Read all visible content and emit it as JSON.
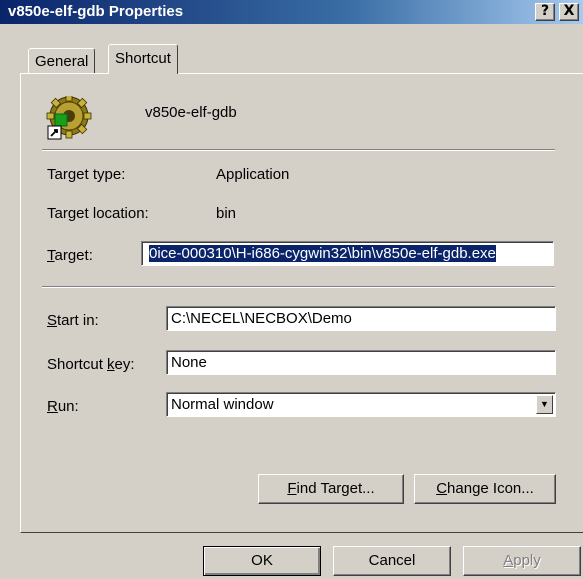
{
  "window": {
    "title": "v850e-elf-gdb  Properties",
    "help_glyph": "?",
    "close_glyph": "X"
  },
  "tabs": [
    {
      "label": "General",
      "active": false
    },
    {
      "label": "Shortcut",
      "active": true
    }
  ],
  "shortcut": {
    "icon": "gear-shortcut-icon",
    "name": "v850e-elf-gdb",
    "target_type": {
      "label": "Target type:",
      "value": "Application"
    },
    "target_location": {
      "label": "Target location:",
      "value": "bin"
    },
    "target": {
      "label_key": "T",
      "label_rest": "arget:",
      "value": "0ice-000310\\H-i686-cygwin32\\bin\\v850e-elf-gdb.exe"
    },
    "start_in": {
      "label_key": "S",
      "label_rest": "tart in:",
      "value": "C:\\NECEL\\NECBOX\\Demo"
    },
    "shortcut_key": {
      "label_pre": "Shortcut ",
      "label_key": "k",
      "label_rest": "ey:",
      "value": "None"
    },
    "run": {
      "label_key": "R",
      "label_rest": "un:",
      "value": "Normal window"
    }
  },
  "buttons": {
    "find_target": {
      "key": "F",
      "rest": "ind Target..."
    },
    "change_icon": {
      "key": "C",
      "rest": "hange Icon..."
    },
    "ok": "OK",
    "cancel": "Cancel",
    "apply": {
      "key": "A",
      "rest": "pply",
      "enabled": false
    }
  },
  "colors": {
    "titlebar_start": "#0a246a",
    "titlebar_end": "#a6caf0",
    "face": "#d4d0c8",
    "selection": "#0a246a"
  }
}
